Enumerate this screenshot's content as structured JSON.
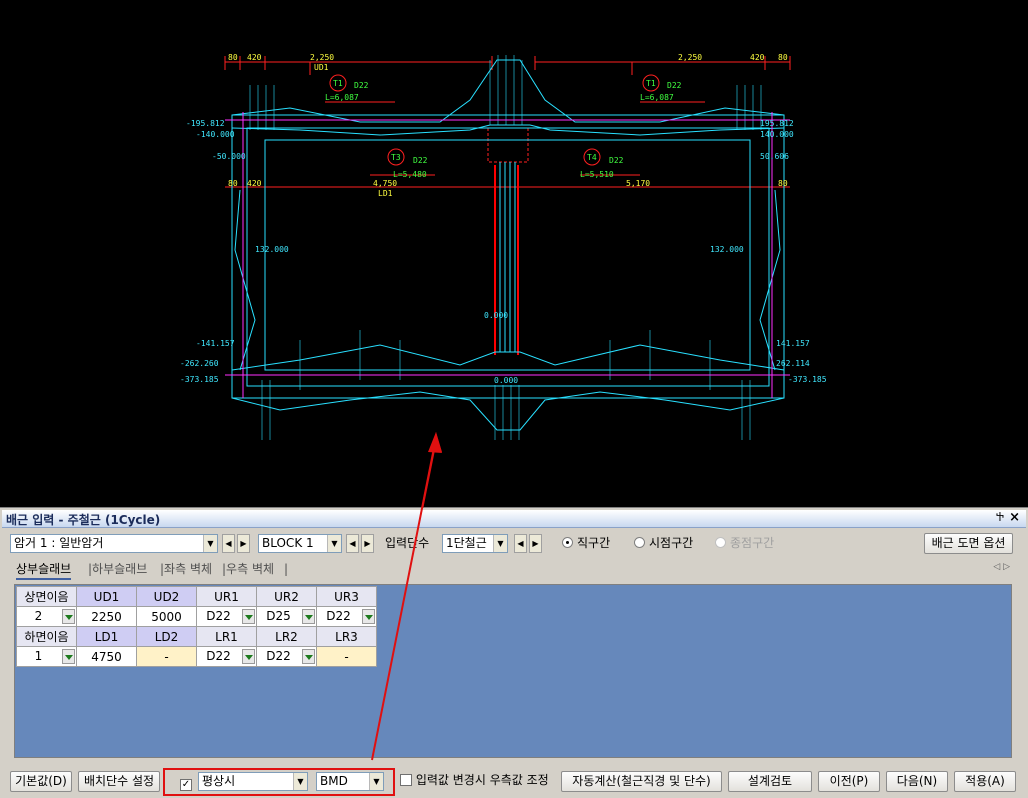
{
  "panel": {
    "title": "배근 입력 - 주철근 (1Cycle)",
    "pin_icon": "pin-icon",
    "close_icon": "close-icon"
  },
  "toolbar": {
    "girder_select": "암거 1 : 일반암거",
    "block_select": "BLOCK  1",
    "input_level_label": "입력단수",
    "input_level_select": "1단철근",
    "radio_straight": "직구간",
    "radio_start": "시점구간",
    "radio_end": "종점구간",
    "rebar_drawing_option": "배근 도면 옵션"
  },
  "tabs": [
    {
      "label": "상부슬래브"
    },
    {
      "label": "|하부슬래브"
    },
    {
      "label": "|좌측 벽체"
    },
    {
      "label": "|우측 벽체"
    },
    {
      "label": "|"
    }
  ],
  "grid": {
    "row1_headers": [
      "상면이음",
      "UD1",
      "UD2",
      "UR1",
      "UR2",
      "UR3"
    ],
    "row1_values": [
      "2",
      "2250",
      "5000",
      "D22",
      "D25",
      "D22"
    ],
    "row2_headers": [
      "하면이음",
      "LD1",
      "LD2",
      "LR1",
      "LR2",
      "LR3"
    ],
    "row2_values": [
      "1",
      "4750",
      "-",
      "D22",
      "D22",
      "-"
    ]
  },
  "bottom": {
    "default_btn": "기본값(D)",
    "arrange_btn": "배치단수 설정",
    "normal_check": "✓",
    "normal_select": "평상시",
    "bmd_select": "BMD",
    "adjust_label": "입력값 변경시 우측값 조정",
    "auto_calc_btn": "자동계산(철근직경 및 단수)",
    "design_check_btn": "설계검토",
    "prev_btn": "이전(P)",
    "next_btn": "다음(N)",
    "apply_btn": "적용(A)"
  },
  "cad": {
    "dims_top": [
      "80",
      "420",
      "2,250",
      "2,250",
      "420",
      "80"
    ],
    "ud1": "UD1",
    "ld1": "LD1",
    "ld1_len": "4,750",
    "ld1_len2": "5,170",
    "t1a": "T1",
    "t1b": "T1",
    "t3": "T3",
    "t4": "T4",
    "d22": "D22",
    "l6087": "L=6,087",
    "l5480": "L=5,480",
    "l5510": "L=5,510",
    "left_vals": [
      "-195.812",
      "-140.000",
      "-50.000",
      "132.000",
      "-141.157",
      "-262.260",
      "-373.185"
    ],
    "right_vals": [
      "195.812",
      "140.000",
      "50.606",
      "132.000",
      "141.157",
      "262.114",
      "-373.185"
    ],
    "mid_val": "0.000",
    "dim80": "80",
    "dim420": "420"
  }
}
